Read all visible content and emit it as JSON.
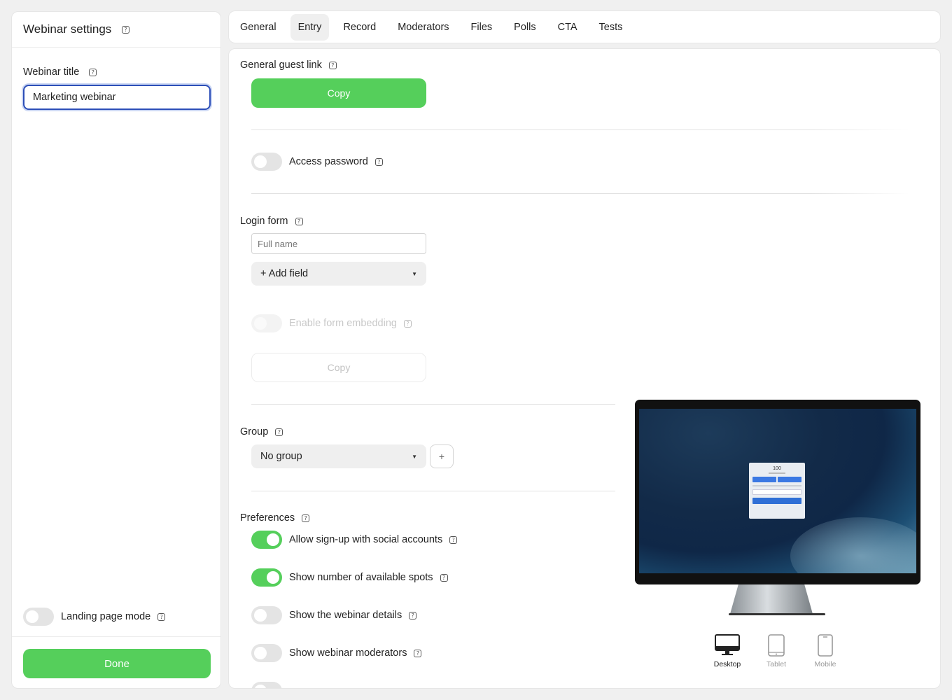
{
  "sidebar": {
    "title": "Webinar settings",
    "webinar_title_label": "Webinar title",
    "webinar_title_value": "Marketing webinar",
    "landing_page_mode_label": "Landing page mode",
    "done_label": "Done"
  },
  "tabs": [
    {
      "label": "General"
    },
    {
      "label": "Entry"
    },
    {
      "label": "Record"
    },
    {
      "label": "Moderators"
    },
    {
      "label": "Files"
    },
    {
      "label": "Polls"
    },
    {
      "label": "CTA"
    },
    {
      "label": "Tests"
    }
  ],
  "active_tab": "Entry",
  "entry": {
    "guest_link_label": "General guest link",
    "copy_label": "Copy",
    "access_password_label": "Access password",
    "login_form_label": "Login form",
    "full_name_placeholder": "Full name",
    "add_field_label": "+ Add field",
    "enable_embedding_label": "Enable form embedding",
    "embed_copy_label": "Copy",
    "group_label": "Group",
    "group_value": "No group",
    "group_add_symbol": "+",
    "preferences_label": "Preferences",
    "preferences": [
      {
        "label": "Allow sign-up with social accounts",
        "enabled": true
      },
      {
        "label": "Show number of available spots",
        "enabled": true
      },
      {
        "label": "Show the webinar details",
        "enabled": false
      },
      {
        "label": "Show webinar moderators",
        "enabled": false
      }
    ]
  },
  "preview": {
    "spots_count": "100",
    "devices": [
      {
        "label": "Desktop",
        "icon": "desktop-icon",
        "active": true
      },
      {
        "label": "Tablet",
        "icon": "tablet-icon",
        "active": false
      },
      {
        "label": "Mobile",
        "icon": "mobile-icon",
        "active": false
      }
    ]
  },
  "colors": {
    "accent_green": "#55cf5b",
    "focus_blue": "#2d4fb8"
  }
}
